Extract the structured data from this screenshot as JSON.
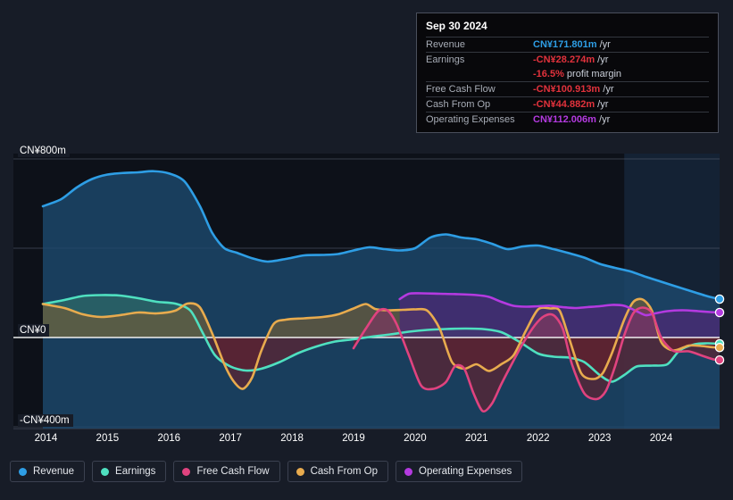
{
  "tooltip": {
    "date": "Sep 30 2024",
    "rows": [
      {
        "key": "Revenue",
        "value": "CN¥171.801m",
        "unit": "/yr",
        "color": "revenue"
      },
      {
        "key": "Earnings",
        "value": "-CN¥28.274m",
        "unit": "/yr",
        "color": "negative"
      },
      {
        "key": "",
        "value": "-16.5%",
        "unit": "profit margin",
        "color": "negative"
      },
      {
        "key": "Free Cash Flow",
        "value": "-CN¥100.913m",
        "unit": "/yr",
        "color": "negative"
      },
      {
        "key": "Cash From Op",
        "value": "-CN¥44.882m",
        "unit": "/yr",
        "color": "negative"
      },
      {
        "key": "Operating Expenses",
        "value": "CN¥112.006m",
        "unit": "/yr",
        "color": "opex"
      }
    ]
  },
  "legend": [
    {
      "label": "Revenue",
      "color": "#2e9ee5"
    },
    {
      "label": "Earnings",
      "color": "#4fe0c0"
    },
    {
      "label": "Free Cash Flow",
      "color": "#e0437f"
    },
    {
      "label": "Cash From Op",
      "color": "#e8ab4e"
    },
    {
      "label": "Operating Expenses",
      "color": "#b43ae0"
    }
  ],
  "chart_data": {
    "type": "area",
    "title": "",
    "xlabel": "",
    "ylabel": "",
    "currency": "CN¥",
    "ylim": [
      -400,
      800
    ],
    "grid": true,
    "y_ticks": [
      {
        "value": 800,
        "label": "CN¥800m"
      },
      {
        "value": 400,
        "label": ""
      },
      {
        "value": 0,
        "label": "CN¥0"
      },
      {
        "value": -400,
        "label": "-CN¥400m"
      }
    ],
    "x_ticks": [
      "2014",
      "2015",
      "2016",
      "2017",
      "2018",
      "2019",
      "2020",
      "2021",
      "2022",
      "2023",
      "2024"
    ],
    "x_range": [
      2013.95,
      2024.95
    ],
    "forecast_start": 2023.4,
    "series": [
      {
        "name": "Revenue",
        "color": "#2e9ee5",
        "fill": "#1d4a6e",
        "points": [
          [
            2013.95,
            588
          ],
          [
            2014.25,
            620
          ],
          [
            2014.5,
            672
          ],
          [
            2014.75,
            710
          ],
          [
            2015.0,
            730
          ],
          [
            2015.25,
            737
          ],
          [
            2015.5,
            740
          ],
          [
            2015.75,
            745
          ],
          [
            2016.0,
            735
          ],
          [
            2016.25,
            700
          ],
          [
            2016.5,
            590
          ],
          [
            2016.7,
            470
          ],
          [
            2016.9,
            400
          ],
          [
            2017.1,
            380
          ],
          [
            2017.35,
            355
          ],
          [
            2017.6,
            340
          ],
          [
            2017.9,
            352
          ],
          [
            2018.2,
            368
          ],
          [
            2018.5,
            370
          ],
          [
            2018.75,
            374
          ],
          [
            2019.0,
            390
          ],
          [
            2019.25,
            404
          ],
          [
            2019.5,
            396
          ],
          [
            2019.75,
            390
          ],
          [
            2020.0,
            400
          ],
          [
            2020.25,
            448
          ],
          [
            2020.5,
            462
          ],
          [
            2020.75,
            448
          ],
          [
            2021.0,
            440
          ],
          [
            2021.25,
            420
          ],
          [
            2021.5,
            396
          ],
          [
            2021.75,
            408
          ],
          [
            2022.0,
            412
          ],
          [
            2022.25,
            396
          ],
          [
            2022.5,
            378
          ],
          [
            2022.75,
            358
          ],
          [
            2023.0,
            330
          ],
          [
            2023.25,
            312
          ],
          [
            2023.5,
            296
          ],
          [
            2023.75,
            272
          ],
          [
            2024.0,
            250
          ],
          [
            2024.4,
            215
          ],
          [
            2024.75,
            185
          ],
          [
            2024.95,
            172
          ]
        ]
      },
      {
        "name": "Earnings",
        "color": "#4fe0c0",
        "fill_pos": "#2e6b68",
        "fill_neg": "#5d2230",
        "points": [
          [
            2013.95,
            150
          ],
          [
            2014.3,
            168
          ],
          [
            2014.6,
            186
          ],
          [
            2014.9,
            190
          ],
          [
            2015.2,
            188
          ],
          [
            2015.5,
            176
          ],
          [
            2015.8,
            160
          ],
          [
            2016.1,
            152
          ],
          [
            2016.35,
            120
          ],
          [
            2016.55,
            20
          ],
          [
            2016.75,
            -80
          ],
          [
            2017.0,
            -130
          ],
          [
            2017.25,
            -148
          ],
          [
            2017.5,
            -140
          ],
          [
            2017.8,
            -110
          ],
          [
            2018.1,
            -70
          ],
          [
            2018.4,
            -40
          ],
          [
            2018.7,
            -18
          ],
          [
            2019.0,
            -8
          ],
          [
            2019.3,
            4
          ],
          [
            2019.6,
            14
          ],
          [
            2019.9,
            26
          ],
          [
            2020.2,
            34
          ],
          [
            2020.5,
            38
          ],
          [
            2020.8,
            40
          ],
          [
            2021.1,
            38
          ],
          [
            2021.4,
            24
          ],
          [
            2021.7,
            -20
          ],
          [
            2022.0,
            -72
          ],
          [
            2022.25,
            -86
          ],
          [
            2022.5,
            -90
          ],
          [
            2022.75,
            -110
          ],
          [
            2023.0,
            -168
          ],
          [
            2023.2,
            -198
          ],
          [
            2023.4,
            -168
          ],
          [
            2023.6,
            -130
          ],
          [
            2023.85,
            -126
          ],
          [
            2024.1,
            -120
          ],
          [
            2024.3,
            -58
          ],
          [
            2024.55,
            -30
          ],
          [
            2024.75,
            -26
          ],
          [
            2024.95,
            -28
          ]
        ]
      },
      {
        "name": "Free Cash Flow",
        "color": "#e0437f",
        "fill_pos": "#7a3760",
        "fill_neg": "#5d2230",
        "start": 2019.0,
        "points": [
          [
            2019.0,
            -48
          ],
          [
            2019.2,
            40
          ],
          [
            2019.4,
            118
          ],
          [
            2019.55,
            122
          ],
          [
            2019.7,
            60
          ],
          [
            2019.9,
            -80
          ],
          [
            2020.1,
            -216
          ],
          [
            2020.3,
            -230
          ],
          [
            2020.5,
            -200
          ],
          [
            2020.65,
            -128
          ],
          [
            2020.8,
            -140
          ],
          [
            2020.95,
            -250
          ],
          [
            2021.1,
            -330
          ],
          [
            2021.25,
            -296
          ],
          [
            2021.4,
            -210
          ],
          [
            2021.55,
            -130
          ],
          [
            2021.75,
            -28
          ],
          [
            2021.95,
            56
          ],
          [
            2022.1,
            96
          ],
          [
            2022.25,
            100
          ],
          [
            2022.4,
            40
          ],
          [
            2022.55,
            -120
          ],
          [
            2022.75,
            -250
          ],
          [
            2022.95,
            -276
          ],
          [
            2023.1,
            -240
          ],
          [
            2023.25,
            -130
          ],
          [
            2023.4,
            10
          ],
          [
            2023.55,
            110
          ],
          [
            2023.7,
            134
          ],
          [
            2023.85,
            110
          ],
          [
            2024.0,
            0
          ],
          [
            2024.2,
            -60
          ],
          [
            2024.45,
            -62
          ],
          [
            2024.65,
            -80
          ],
          [
            2024.85,
            -98
          ],
          [
            2024.95,
            -101
          ]
        ]
      },
      {
        "name": "Cash From Op",
        "color": "#e8ab4e",
        "fill_pos": "#6b5c3a",
        "fill_neg": "#5d2230",
        "points": [
          [
            2013.95,
            150
          ],
          [
            2014.3,
            132
          ],
          [
            2014.6,
            104
          ],
          [
            2014.9,
            92
          ],
          [
            2015.2,
            100
          ],
          [
            2015.5,
            112
          ],
          [
            2015.8,
            108
          ],
          [
            2016.1,
            120
          ],
          [
            2016.3,
            152
          ],
          [
            2016.5,
            136
          ],
          [
            2016.7,
            20
          ],
          [
            2016.9,
            -120
          ],
          [
            2017.05,
            -196
          ],
          [
            2017.2,
            -230
          ],
          [
            2017.35,
            -180
          ],
          [
            2017.5,
            -60
          ],
          [
            2017.7,
            60
          ],
          [
            2017.9,
            80
          ],
          [
            2018.2,
            86
          ],
          [
            2018.5,
            92
          ],
          [
            2018.75,
            104
          ],
          [
            2019.0,
            130
          ],
          [
            2019.2,
            150
          ],
          [
            2019.35,
            128
          ],
          [
            2019.55,
            122
          ],
          [
            2019.8,
            124
          ],
          [
            2020.0,
            126
          ],
          [
            2020.2,
            120
          ],
          [
            2020.4,
            40
          ],
          [
            2020.6,
            -110
          ],
          [
            2020.8,
            -140
          ],
          [
            2021.0,
            -120
          ],
          [
            2021.2,
            -150
          ],
          [
            2021.4,
            -120
          ],
          [
            2021.6,
            -80
          ],
          [
            2021.8,
            30
          ],
          [
            2022.0,
            126
          ],
          [
            2022.2,
            130
          ],
          [
            2022.35,
            120
          ],
          [
            2022.5,
            0
          ],
          [
            2022.7,
            -160
          ],
          [
            2022.9,
            -186
          ],
          [
            2023.05,
            -160
          ],
          [
            2023.2,
            -70
          ],
          [
            2023.4,
            80
          ],
          [
            2023.55,
            160
          ],
          [
            2023.7,
            170
          ],
          [
            2023.85,
            120
          ],
          [
            2024.0,
            -20
          ],
          [
            2024.2,
            -58
          ],
          [
            2024.45,
            -36
          ],
          [
            2024.65,
            -38
          ],
          [
            2024.85,
            -44
          ],
          [
            2024.95,
            -45
          ]
        ]
      },
      {
        "name": "Operating Expenses",
        "color": "#b43ae0",
        "fill": "#4a2a74",
        "start": 2019.75,
        "points": [
          [
            2019.75,
            172
          ],
          [
            2019.9,
            196
          ],
          [
            2020.1,
            198
          ],
          [
            2020.4,
            196
          ],
          [
            2020.7,
            194
          ],
          [
            2021.0,
            190
          ],
          [
            2021.2,
            182
          ],
          [
            2021.4,
            160
          ],
          [
            2021.6,
            142
          ],
          [
            2021.8,
            138
          ],
          [
            2022.0,
            140
          ],
          [
            2022.2,
            142
          ],
          [
            2022.4,
            136
          ],
          [
            2022.6,
            132
          ],
          [
            2022.8,
            136
          ],
          [
            2023.0,
            140
          ],
          [
            2023.2,
            146
          ],
          [
            2023.4,
            142
          ],
          [
            2023.6,
            118
          ],
          [
            2023.75,
            100
          ],
          [
            2023.9,
            108
          ],
          [
            2024.1,
            118
          ],
          [
            2024.35,
            122
          ],
          [
            2024.6,
            118
          ],
          [
            2024.8,
            114
          ],
          [
            2024.95,
            112
          ]
        ]
      }
    ],
    "endpoints": [
      {
        "name": "Revenue",
        "value": 172,
        "color": "#2e9ee5"
      },
      {
        "name": "Operating Expenses",
        "value": 112,
        "color": "#b43ae0"
      },
      {
        "name": "Earnings",
        "value": -28,
        "color": "#4fe0c0"
      },
      {
        "name": "Cash From Op",
        "value": -45,
        "color": "#e8ab4e"
      },
      {
        "name": "Free Cash Flow",
        "value": -101,
        "color": "#e0437f"
      }
    ]
  }
}
